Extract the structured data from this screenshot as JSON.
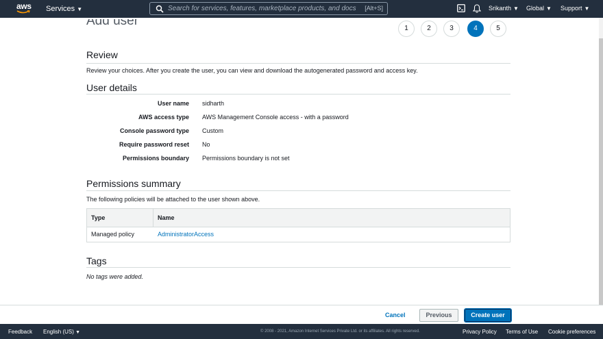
{
  "nav": {
    "logo": "aws",
    "services": "Services",
    "search_placeholder": "Search for services, features, marketplace products, and docs",
    "search_shortcut": "[Alt+S]",
    "user": "Srikanth",
    "region": "Global",
    "support": "Support"
  },
  "wizard": {
    "title": "Add user",
    "steps": [
      "1",
      "2",
      "3",
      "4",
      "5"
    ],
    "active_step": "4"
  },
  "review": {
    "heading": "Review",
    "description": "Review your choices. After you create the user, you can view and download the autogenerated password and access key."
  },
  "user_details": {
    "heading": "User details",
    "rows": [
      {
        "label": "User name",
        "value": "sidharth"
      },
      {
        "label": "AWS access type",
        "value": "AWS Management Console access - with a password"
      },
      {
        "label": "Console password type",
        "value": "Custom"
      },
      {
        "label": "Require password reset",
        "value": "No"
      },
      {
        "label": "Permissions boundary",
        "value": "Permissions boundary is not set"
      }
    ]
  },
  "permissions": {
    "heading": "Permissions summary",
    "description": "The following policies will be attached to the user shown above.",
    "columns": [
      "Type",
      "Name"
    ],
    "rows": [
      {
        "type": "Managed policy",
        "name": "AdministratorAccess"
      }
    ]
  },
  "tags": {
    "heading": "Tags",
    "empty": "No tags were added."
  },
  "actions": {
    "cancel": "Cancel",
    "previous": "Previous",
    "create": "Create user"
  },
  "footer": {
    "feedback": "Feedback",
    "language": "English (US)",
    "copyright": "© 2008 - 2021, Amazon Internet Services Private Ltd. or its affiliates. All rights reserved.",
    "privacy": "Privacy Policy",
    "terms": "Terms of Use",
    "cookies": "Cookie preferences"
  }
}
